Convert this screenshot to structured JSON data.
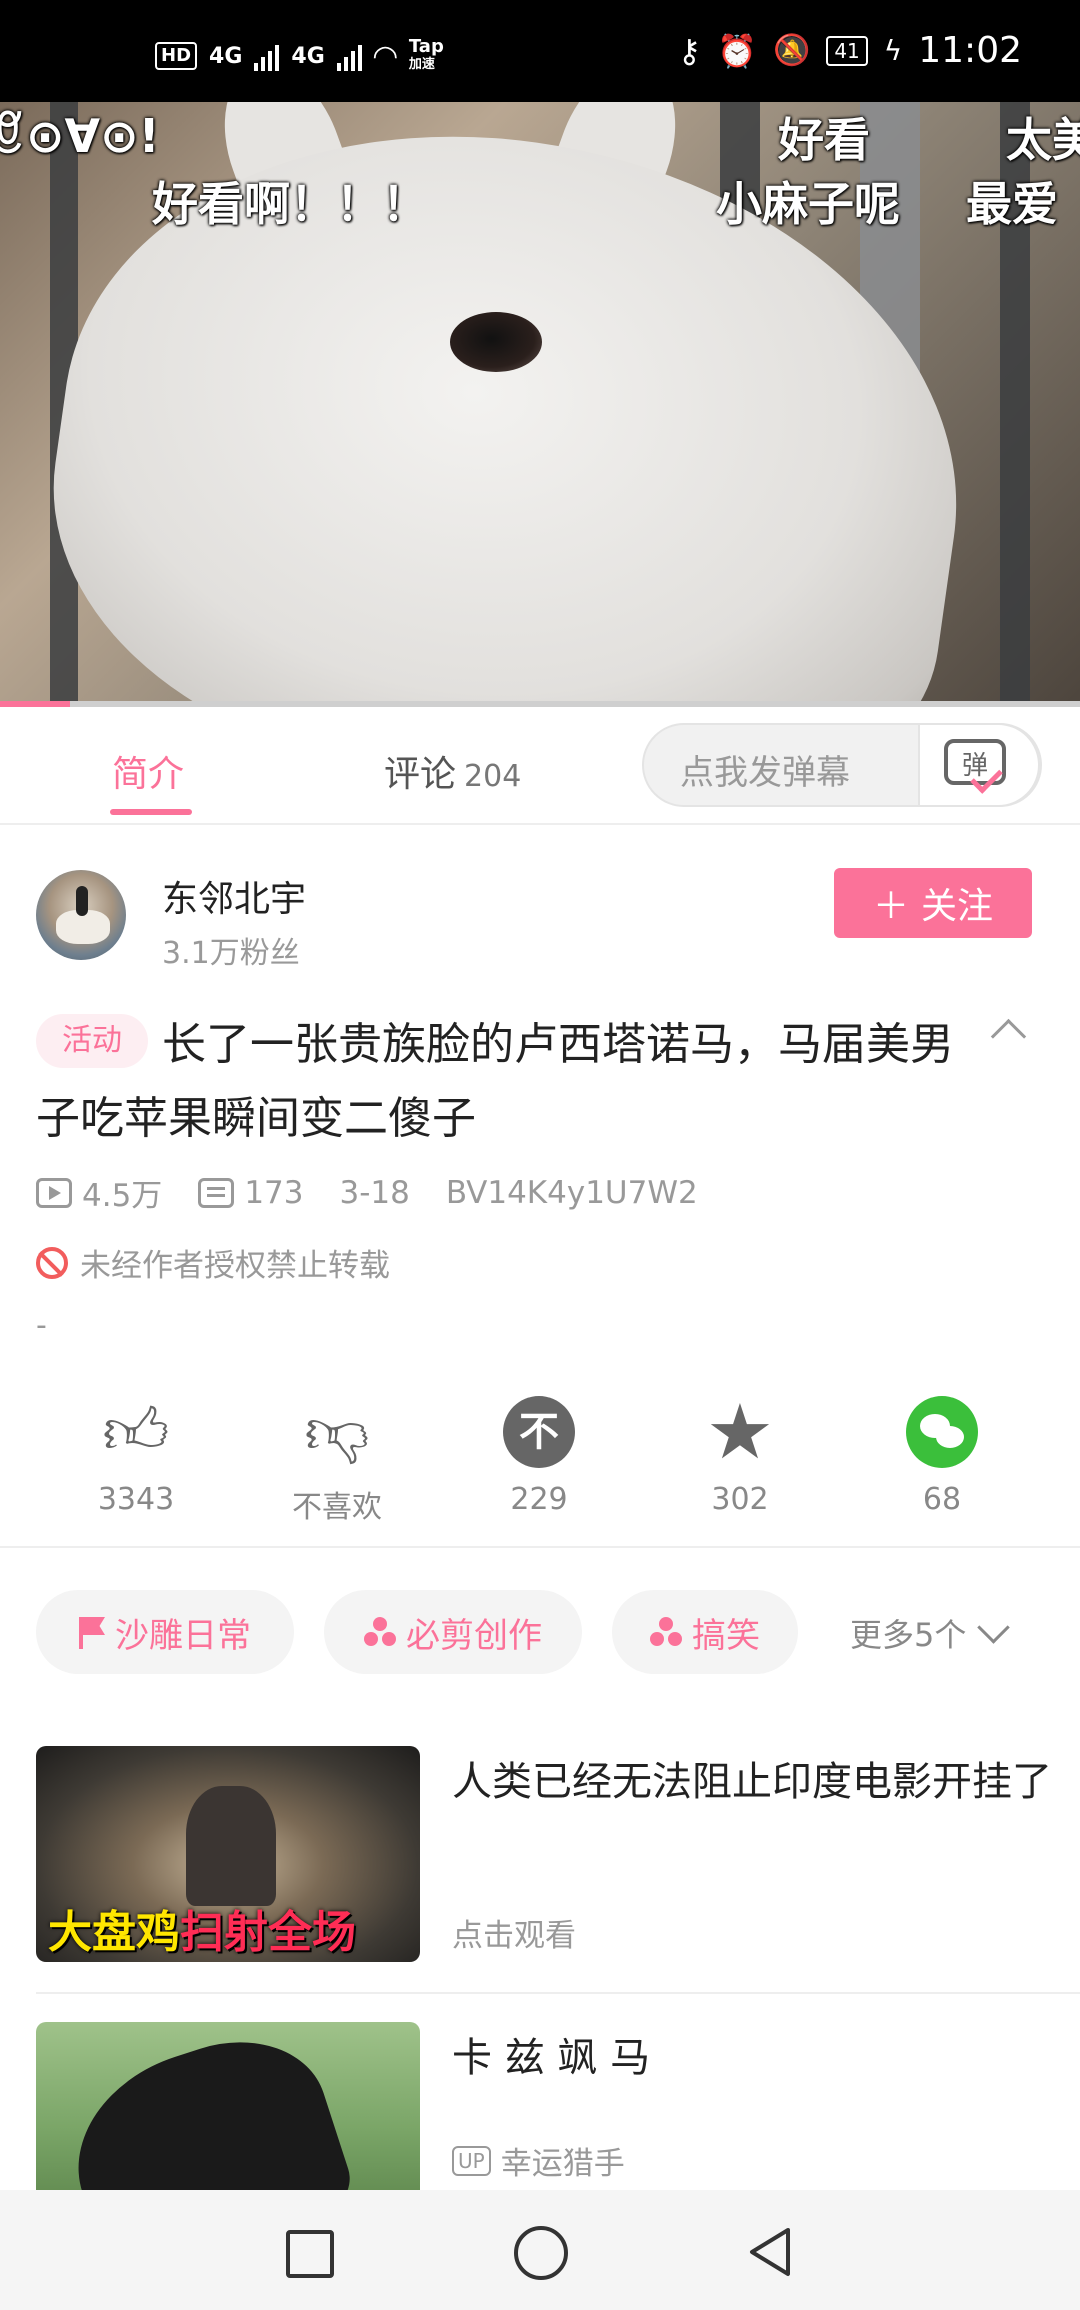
{
  "status_bar": {
    "network_badge": "HD",
    "sim1": "4G",
    "sim2": "4G",
    "tap_label": "Tap",
    "tap_sub": "加速",
    "battery": "41",
    "time": "11:02"
  },
  "video": {
    "danmaku": [
      "ꆚ⊙∀⊙!",
      "好看",
      "太美",
      "好看啊！！！",
      "小麻子呢",
      "最爱"
    ],
    "progress": 0.065
  },
  "tabs": {
    "intro_label": "简介",
    "comments_label": "评论",
    "comments_count": "204",
    "danmaku_placeholder": "点我发弹幕",
    "danmaku_button_char": "弹"
  },
  "uploader": {
    "name": "东邻北宇",
    "fans": "3.1万粉丝",
    "follow_label": "关注",
    "follow_icon": "＋"
  },
  "video_info": {
    "activity_tag": "活动",
    "title": "长了一张贵族脸的卢西塔诺马，马届美男子吃苹果瞬间变二傻子",
    "views": "4.5万",
    "danmaku_count": "173",
    "date": "3-18",
    "bvid": "BV14K4y1U7W2",
    "copyright_notice": "未经作者授权禁止转载",
    "description": "-"
  },
  "actions": [
    {
      "icon": "like-icon",
      "label": "3343"
    },
    {
      "icon": "dislike-icon",
      "label": "不喜欢"
    },
    {
      "icon": "coin-icon",
      "label": "229"
    },
    {
      "icon": "favorite-icon",
      "label": "302"
    },
    {
      "icon": "wechat-share-icon",
      "label": "68"
    }
  ],
  "coin_glyph": "不",
  "tags": [
    {
      "icon": "flag-icon",
      "label": "沙雕日常"
    },
    {
      "icon": "creation-icon",
      "label": "必剪创作"
    },
    {
      "icon": "creation-icon",
      "label": "搞笑"
    }
  ],
  "more_tags_label": "更多5个",
  "recommendations": [
    {
      "title": "人类已经无法阻止印度电影开挂了",
      "subtitle": "点击观看",
      "thumb_text_yellow": "大盘鸡",
      "thumb_text_red": "扫射全场"
    },
    {
      "title": "卡 兹 飒 马",
      "up_badge": "UP",
      "subtitle": "幸运猎手"
    }
  ],
  "colors": {
    "accent": "#fb7299",
    "wechat": "#3bbf3b",
    "warning": "#f25d5d"
  }
}
